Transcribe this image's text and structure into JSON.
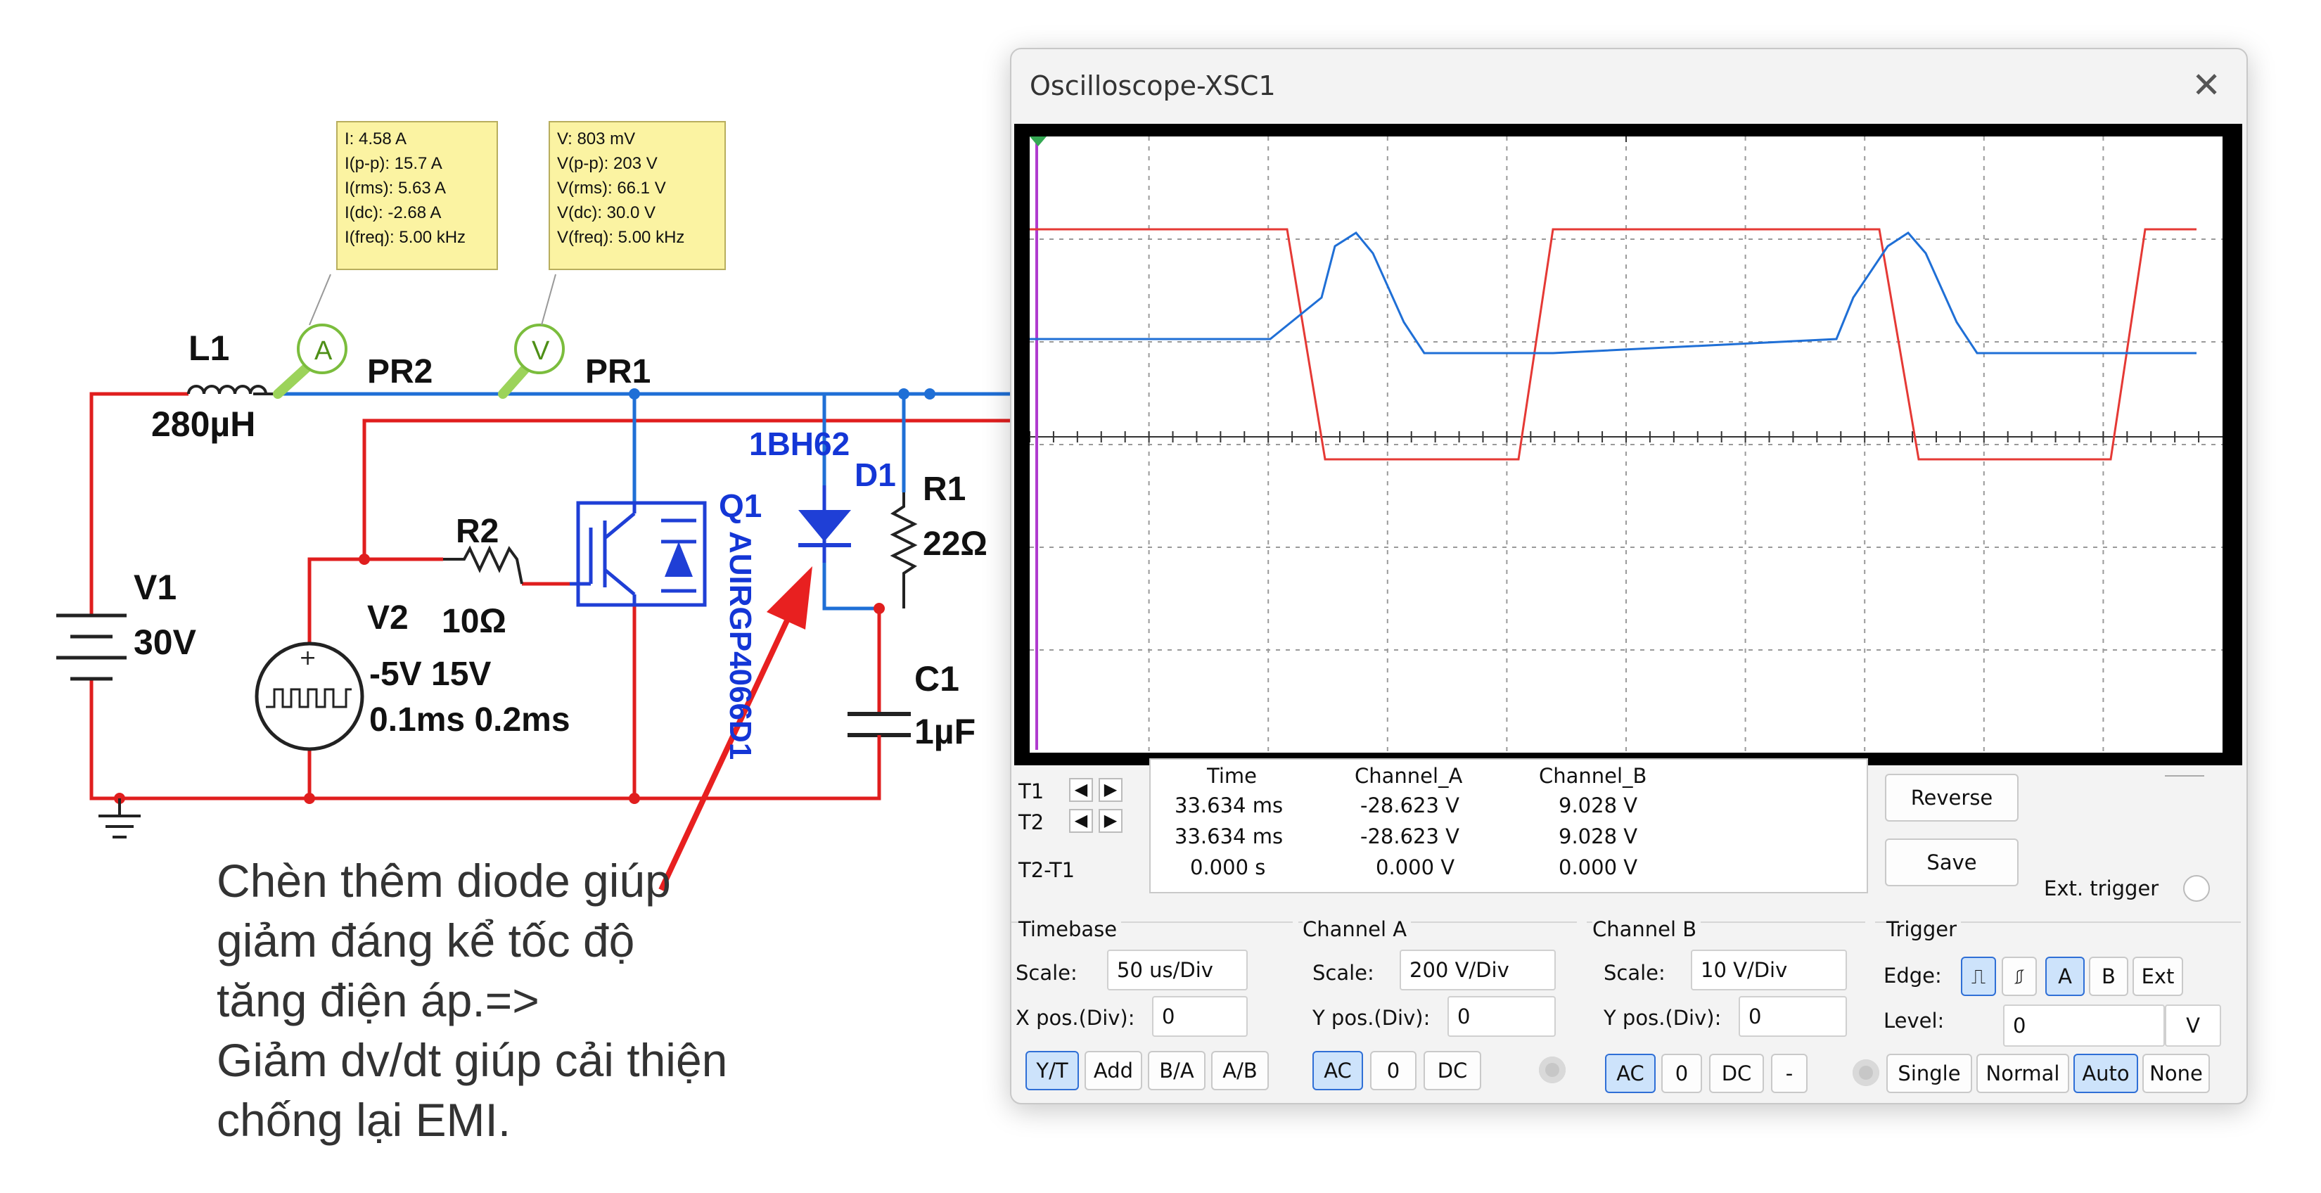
{
  "circuit": {
    "inductor": {
      "name": "L1",
      "value": "280µH"
    },
    "supply": {
      "name": "V1",
      "value": "30V"
    },
    "probe_current": {
      "symbol": "A",
      "name": "PR2"
    },
    "probe_voltage": {
      "symbol": "V",
      "name": "PR1"
    },
    "ammeter_readings": [
      "I: 4.58 A",
      "I(p-p): 15.7 A",
      "I(rms): 5.63 A",
      "I(dc): -2.68 A",
      "I(freq): 5.00 kHz"
    ],
    "voltmeter_readings": [
      "V: 803 mV",
      "V(p-p): 203 V",
      "V(rms): 66.1 V",
      "V(dc): 30.0 V",
      "V(freq): 5.00 kHz"
    ],
    "diode": {
      "part": "1BH62",
      "name": "D1"
    },
    "r1": {
      "name": "R1",
      "value": "22Ω"
    },
    "r2": {
      "name": "R2",
      "value": "10Ω"
    },
    "transistor": {
      "name": "Q1",
      "part": "AUIRGP4066D1"
    },
    "pulse_source": {
      "name": "V2",
      "line1": "-5V 15V",
      "line2": "0.1ms 0.2ms"
    },
    "capacitor": {
      "name": "C1",
      "value": "1µF"
    },
    "annotation": [
      "Chèn thêm diode giúp",
      "giảm đáng kể tốc độ",
      "tăng điện áp.=>",
      "Giảm dv/dt giúp cải thiện",
      "chống lại EMI."
    ]
  },
  "oscilloscope": {
    "title": "Oscilloscope-XSC1",
    "channel_colors": {
      "a": "#e53935",
      "b": "#1f6fd6"
    },
    "readout": {
      "headers": [
        "Time",
        "Channel_A",
        "Channel_B"
      ],
      "rows": [
        {
          "label": "T1",
          "time": "33.634 ms",
          "a": "-28.623 V",
          "b": "9.028 V"
        },
        {
          "label": "T2",
          "time": "33.634 ms",
          "a": "-28.623 V",
          "b": "9.028 V"
        },
        {
          "label": "T2-T1",
          "time": "0.000 s",
          "a": "0.000 V",
          "b": "0.000 V"
        }
      ]
    },
    "buttons": {
      "reverse": "Reverse",
      "save": "Save",
      "ext_trigger": "Ext. trigger"
    },
    "timebase": {
      "title": "Timebase",
      "scale_label": "Scale:",
      "scale": "50 us/Div",
      "pos_label": "X pos.(Div):",
      "pos": "0",
      "modes": [
        "Y/T",
        "Add",
        "B/A",
        "A/B"
      ],
      "active_mode": "Y/T"
    },
    "channel_a": {
      "title": "Channel A",
      "scale_label": "Scale:",
      "scale": "200  V/Div",
      "pos_label": "Y pos.(Div):",
      "pos": "0",
      "coupling": [
        "AC",
        "0",
        "DC"
      ],
      "active": "AC"
    },
    "channel_b": {
      "title": "Channel B",
      "scale_label": "Scale:",
      "scale": "10  V/Div",
      "pos_label": "Y pos.(Div):",
      "pos": "0",
      "coupling": [
        "AC",
        "0",
        "DC",
        "-"
      ],
      "active": "AC"
    },
    "trigger": {
      "title": "Trigger",
      "edge_label": "Edge:",
      "level_label": "Level:",
      "level": "0",
      "level_unit": "V",
      "sources": [
        "A",
        "B",
        "Ext"
      ],
      "active_source": "A",
      "modes": [
        "Single",
        "Normal",
        "Auto",
        "None"
      ],
      "active_mode": "Auto"
    }
  }
}
